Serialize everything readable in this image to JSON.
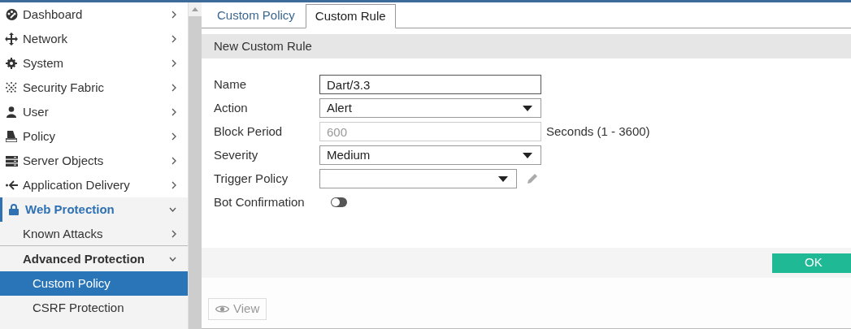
{
  "sidebar": {
    "items": [
      {
        "label": "Dashboard",
        "expanded": false,
        "selected": false
      },
      {
        "label": "Network",
        "expanded": false,
        "selected": false
      },
      {
        "label": "System",
        "expanded": false,
        "selected": false
      },
      {
        "label": "Security Fabric",
        "expanded": false,
        "selected": false
      },
      {
        "label": "User",
        "expanded": false,
        "selected": false
      },
      {
        "label": "Policy",
        "expanded": false,
        "selected": false
      },
      {
        "label": "Server Objects",
        "expanded": false,
        "selected": false
      },
      {
        "label": "Application Delivery",
        "expanded": false,
        "selected": false
      },
      {
        "label": "Web Protection",
        "expanded": true,
        "selected": true,
        "children": [
          {
            "label": "Known Attacks",
            "expanded": false,
            "selected": false
          },
          {
            "label": "Advanced Protection",
            "expanded": true,
            "children": [
              {
                "label": "Custom Policy",
                "selected": true
              },
              {
                "label": "CSRF Protection",
                "selected": false
              }
            ]
          }
        ]
      }
    ]
  },
  "tabs": [
    {
      "label": "Custom Policy",
      "selected": false
    },
    {
      "label": "Custom Rule",
      "selected": true
    }
  ],
  "form": {
    "title": "New Custom Rule",
    "fields": [
      {
        "kind": "text",
        "label": "Name",
        "value": "Dart/3.3",
        "disabled": false
      },
      {
        "kind": "select",
        "label": "Action",
        "value": "Alert"
      },
      {
        "kind": "text",
        "label": "Block Period",
        "value": "600",
        "disabled": true,
        "suffix": "Seconds (1 - 3600)"
      },
      {
        "kind": "select",
        "label": "Severity",
        "value": "Medium"
      },
      {
        "kind": "select-edit",
        "label": "Trigger Policy"
      },
      {
        "kind": "toggle",
        "label": "Bot Confirmation",
        "on": false
      }
    ],
    "ok_button": "OK"
  },
  "view_button": "View"
}
